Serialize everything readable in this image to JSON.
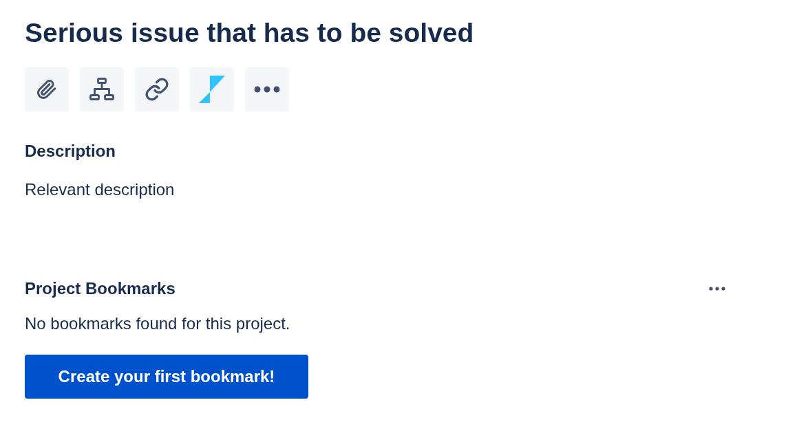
{
  "issue": {
    "title": "Serious issue that has to be solved"
  },
  "toolbar": [
    {
      "kind": "attach"
    },
    {
      "kind": "hierarchy"
    },
    {
      "kind": "link"
    },
    {
      "kind": "app"
    },
    {
      "kind": "more"
    }
  ],
  "description": {
    "heading": "Description",
    "text": "Relevant description"
  },
  "bookmarks": {
    "heading": "Project Bookmarks",
    "empty_message": "No bookmarks found for this project.",
    "button": "Create your first bookmark!"
  }
}
